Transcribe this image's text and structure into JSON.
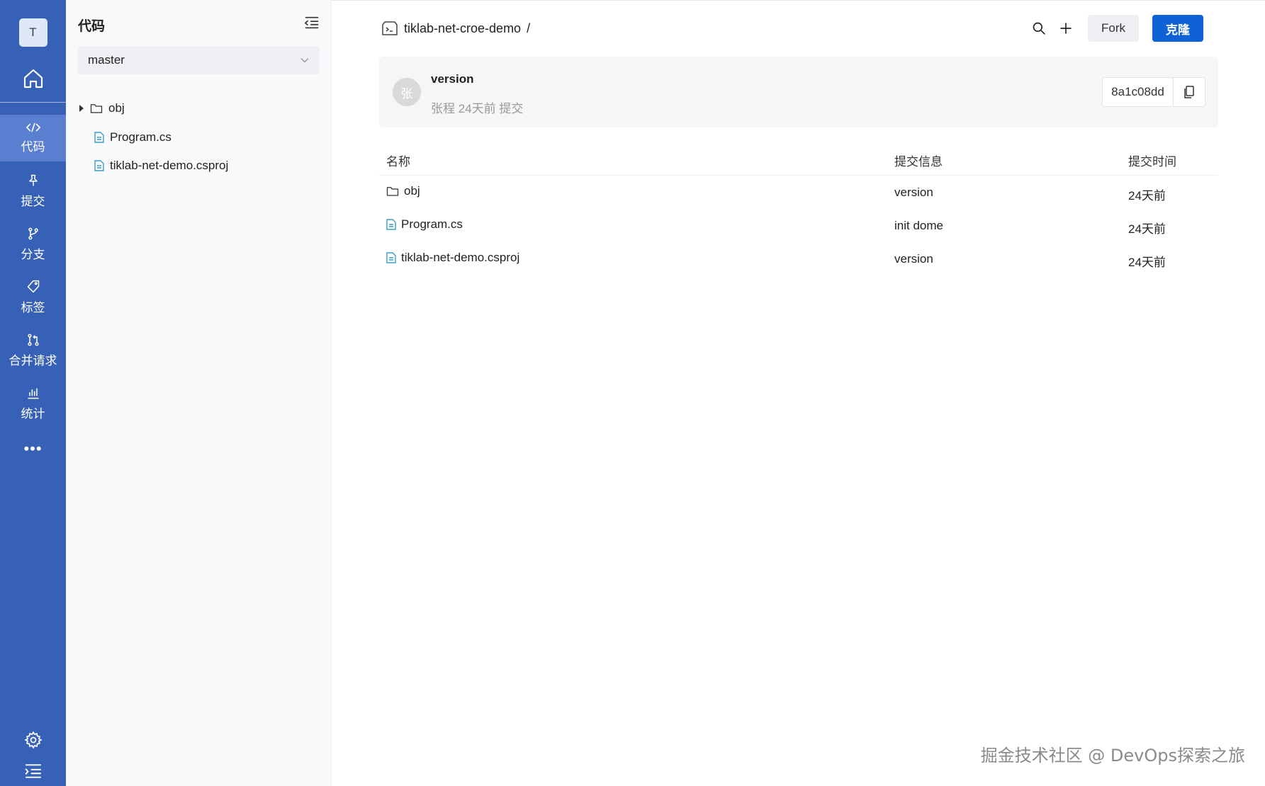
{
  "rail": {
    "avatar_letter": "T",
    "items": [
      {
        "label": "代码",
        "icon": "code-icon"
      },
      {
        "label": "提交",
        "icon": "pin-icon"
      },
      {
        "label": "分支",
        "icon": "branch-icon"
      },
      {
        "label": "标签",
        "icon": "tag-icon"
      },
      {
        "label": "合并请求",
        "icon": "merge-request-icon"
      },
      {
        "label": "统计",
        "icon": "bar-chart-icon"
      }
    ],
    "more": "•••"
  },
  "tree": {
    "title": "代码",
    "branch": "master",
    "items": [
      {
        "name": "obj",
        "type": "folder"
      },
      {
        "name": "Program.cs",
        "type": "file"
      },
      {
        "name": "tiklab-net-demo.csproj",
        "type": "file"
      }
    ]
  },
  "header": {
    "repo": "tiklab-net-croe-demo",
    "separator": "/",
    "fork_label": "Fork",
    "clone_label": "克隆"
  },
  "commit": {
    "avatar_char": "张",
    "message": "version",
    "meta": "张程 24天前 提交",
    "hash": "8a1c08dd"
  },
  "table": {
    "headers": {
      "name": "名称",
      "message": "提交信息",
      "time": "提交时间"
    },
    "rows": [
      {
        "name": "obj",
        "type": "folder",
        "message": "version",
        "time": "24天前"
      },
      {
        "name": "Program.cs",
        "type": "file",
        "message": "init dome",
        "time": "24天前"
      },
      {
        "name": "tiklab-net-demo.csproj",
        "type": "file",
        "message": "version",
        "time": "24天前"
      }
    ]
  },
  "watermark": "掘金技术社区 @ DevOps探索之旅",
  "colors": {
    "rail": "#3761b6",
    "rail_active": "#5a7ed0",
    "primary": "#0f62d6",
    "file_icon": "#3aa0c8"
  }
}
